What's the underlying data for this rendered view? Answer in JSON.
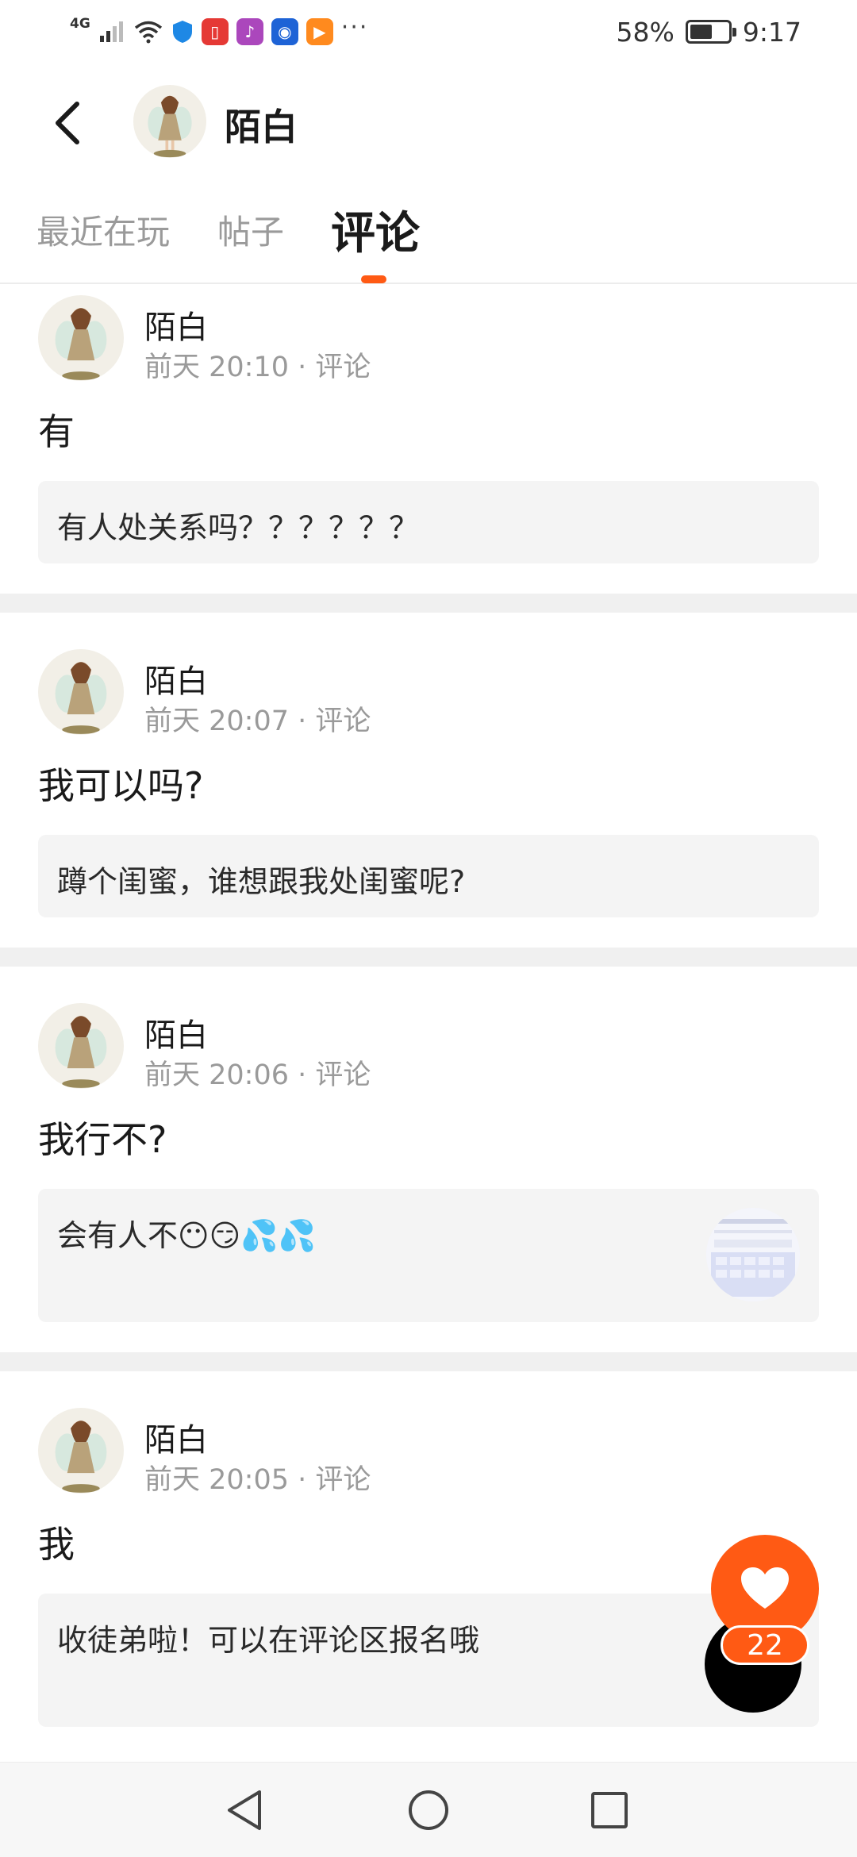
{
  "status_bar": {
    "network": "4G",
    "battery": "58%",
    "battery_level": 0.58,
    "time": "9:17",
    "more": "···"
  },
  "header": {
    "back_icon": "chevron-left-icon",
    "name": "陌白"
  },
  "tabs": [
    {
      "label": "最近在玩",
      "active": false
    },
    {
      "label": "帖子",
      "active": false
    },
    {
      "label": "评论",
      "active": true
    }
  ],
  "accent_color": "#ff5a14",
  "comments": [
    {
      "user": "陌白",
      "time": "前天 20:10",
      "type": "评论",
      "text": "有",
      "quote": "有人处关系吗？？？？？？"
    },
    {
      "user": "陌白",
      "time": "前天 20:07",
      "type": "评论",
      "text": "我可以吗?",
      "quote": "蹲个闺蜜，谁想跟我处闺蜜呢?"
    },
    {
      "user": "陌白",
      "time": "前天 20:06",
      "type": "评论",
      "text": "我行不?",
      "quote": "会有人不😶😏💦💦"
    },
    {
      "user": "陌白",
      "time": "前天 20:05",
      "type": "评论",
      "text": "我",
      "quote": "收徒弟啦！可以在评论区报名哦"
    }
  ],
  "like_count": "22",
  "nav": {
    "back": "back-triangle-icon",
    "home": "home-circle-icon",
    "recents": "recents-square-icon"
  }
}
